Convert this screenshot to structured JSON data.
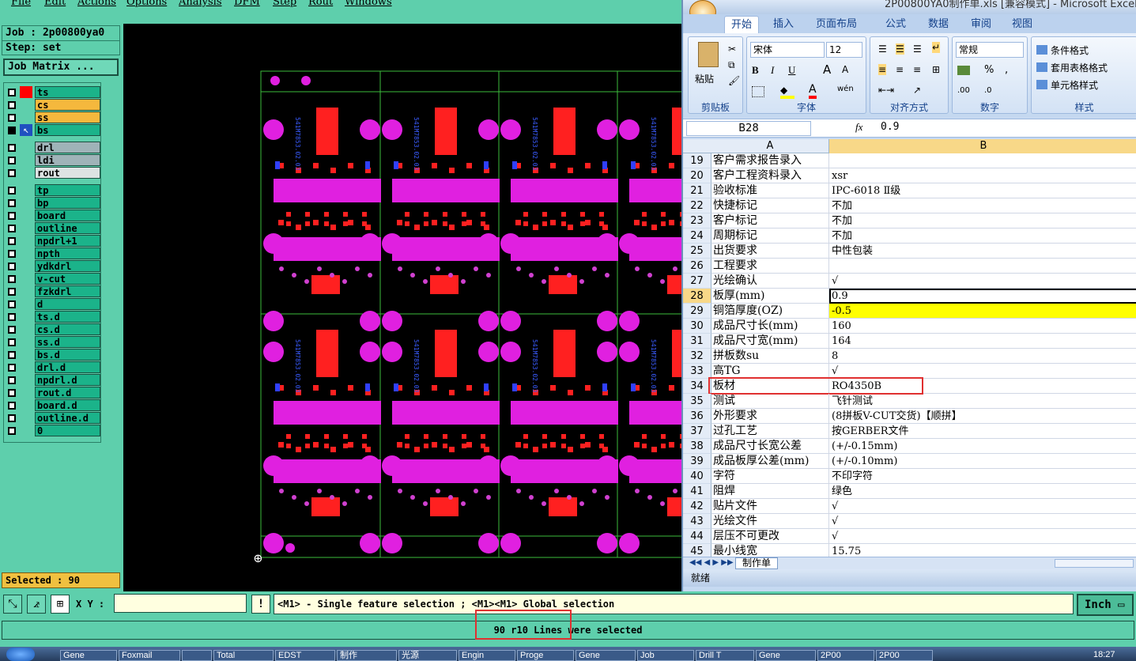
{
  "menubar": [
    "File",
    "Edit",
    "Actions",
    "Options",
    "Analysis",
    "DFM",
    "Step",
    "Rout",
    "Windows"
  ],
  "job": {
    "label": "Job : 2p00800ya0",
    "step": "Step: set",
    "matrix_button": "Job Matrix ..."
  },
  "layers": [
    {
      "name": "ts",
      "color": "#1bb38a",
      "marker": "#ff0000"
    },
    {
      "name": "cs",
      "color": "#f5b83d"
    },
    {
      "name": "ss",
      "color": "#f5b83d"
    },
    {
      "name": "bs",
      "color": "#1bb38a",
      "selected": true
    },
    {
      "name": "drl",
      "color": "#9fb3b8",
      "gap": true
    },
    {
      "name": "ldi",
      "color": "#9fb3b8"
    },
    {
      "name": "rout",
      "color": "#dde3e3"
    },
    {
      "name": "tp",
      "color": "#1bb38a",
      "gap": true
    },
    {
      "name": "bp",
      "color": "#1bb38a"
    },
    {
      "name": "board",
      "color": "#1bb38a"
    },
    {
      "name": "outline",
      "color": "#1bb38a"
    },
    {
      "name": "npdrl+1",
      "color": "#1bb38a"
    },
    {
      "name": "npth",
      "color": "#1bb38a"
    },
    {
      "name": "ydkdrl",
      "color": "#1bb38a"
    },
    {
      "name": "v-cut",
      "color": "#1bb38a"
    },
    {
      "name": "fzkdrl",
      "color": "#1bb38a"
    },
    {
      "name": "d",
      "color": "#1bb38a"
    },
    {
      "name": "ts.d",
      "color": "#1bb38a"
    },
    {
      "name": "cs.d",
      "color": "#1bb38a"
    },
    {
      "name": "ss.d",
      "color": "#1bb38a"
    },
    {
      "name": "bs.d",
      "color": "#1bb38a"
    },
    {
      "name": "drl.d",
      "color": "#1bb38a"
    },
    {
      "name": "npdrl.d",
      "color": "#1bb38a"
    },
    {
      "name": "rout.d",
      "color": "#1bb38a"
    },
    {
      "name": "board.d",
      "color": "#1bb38a"
    },
    {
      "name": "outline.d",
      "color": "#1bb38a"
    },
    {
      "name": "0",
      "color": "#1bb38a"
    }
  ],
  "selected_count": "Selected : 90",
  "board_text": "541M7853.02.03",
  "cmd": {
    "xy_label": "X Y :",
    "xy_value": "",
    "hint": "<M1> - Single feature selection ; <M1><M1> Global selection",
    "unit": "Inch",
    "status": "90 r10 Lines were selected"
  },
  "taskbar": [
    "Gene",
    "Foxmail",
    "",
    "Total",
    "EDST",
    "制作",
    "光源",
    "Engin",
    "Proge",
    "Gene",
    "Job",
    "Drill T",
    "Gene",
    "2P00",
    "2P00",
    "18:27"
  ],
  "excel": {
    "title": "2P00800YA0制作单.xls [兼容模式] - Microsoft Excel",
    "tabs": [
      "开始",
      "插入",
      "页面布局",
      "公式",
      "数据",
      "审阅",
      "视图"
    ],
    "ribbon": {
      "clipboard": {
        "label": "剪贴板",
        "paste": "粘贴"
      },
      "font": {
        "label": "字体",
        "name": "宋体",
        "size": "12",
        "bold": "B",
        "italic": "I",
        "underline": "U",
        "grow": "A",
        "shrink": "A",
        "color_a": "A",
        "phonetic": "wén"
      },
      "align": {
        "label": "对齐方式"
      },
      "number": {
        "label": "数字",
        "format": "常规",
        "percent": "%",
        "comma": ",",
        "inc": ".00",
        "dec": ".0"
      },
      "styles": {
        "label": "样式",
        "cond": "条件格式",
        "table": "套用表格格式",
        "cell": "单元格样式"
      }
    },
    "namebox": "B28",
    "fx": "fx",
    "formula": "0.9",
    "col_headers": [
      "A",
      "B"
    ],
    "rows": [
      {
        "n": "19",
        "a": "客户需求报告录入",
        "b": ""
      },
      {
        "n": "20",
        "a": "客户工程资料录入",
        "b": "xsr"
      },
      {
        "n": "21",
        "a": "验收标准",
        "b": "IPC-6018 Ⅱ级"
      },
      {
        "n": "22",
        "a": "快捷标记",
        "b": "不加"
      },
      {
        "n": "23",
        "a": "客户标记",
        "b": "不加"
      },
      {
        "n": "24",
        "a": "周期标记",
        "b": "不加"
      },
      {
        "n": "25",
        "a": "出货要求",
        "b": "中性包装"
      },
      {
        "n": "26",
        "a": "工程要求",
        "b": ""
      },
      {
        "n": "27",
        "a": "光绘确认",
        "b": "√"
      },
      {
        "n": "28",
        "a": "板厚(mm)",
        "b": "0.9",
        "active": true
      },
      {
        "n": "29",
        "a": "铜箔厚度(OZ)",
        "b": "-0.5",
        "highlight": true
      },
      {
        "n": "30",
        "a": "成品尺寸长(mm)",
        "b": "160"
      },
      {
        "n": "31",
        "a": "成品尺寸宽(mm)",
        "b": "164"
      },
      {
        "n": "32",
        "a": "拼板数su",
        "b": "8"
      },
      {
        "n": "33",
        "a": "高TG",
        "b": "√"
      },
      {
        "n": "34",
        "a": "板材",
        "b": "RO4350B",
        "boxed": true
      },
      {
        "n": "35",
        "a": "测试",
        "b": "飞针测试"
      },
      {
        "n": "36",
        "a": "外形要求",
        "b": "(8拼板V-CUT交货)【顺拼】"
      },
      {
        "n": "37",
        "a": "过孔工艺",
        "b": "按GERBER文件"
      },
      {
        "n": "38",
        "a": "成品尺寸长宽公差",
        "b": "(+/-0.15mm)"
      },
      {
        "n": "39",
        "a": "成品板厚公差(mm)",
        "b": "(+/-0.10mm)"
      },
      {
        "n": "40",
        "a": "字符",
        "b": "不印字符"
      },
      {
        "n": "41",
        "a": "阻焊",
        "b": "绿色"
      },
      {
        "n": "42",
        "a": "贴片文件",
        "b": "√"
      },
      {
        "n": "43",
        "a": "光绘文件",
        "b": "√"
      },
      {
        "n": "44",
        "a": "层压不可更改",
        "b": "√"
      },
      {
        "n": "45",
        "a": "最小线宽",
        "b": "15.75"
      }
    ],
    "sheet_tab": "制作单",
    "status": "就绪"
  }
}
